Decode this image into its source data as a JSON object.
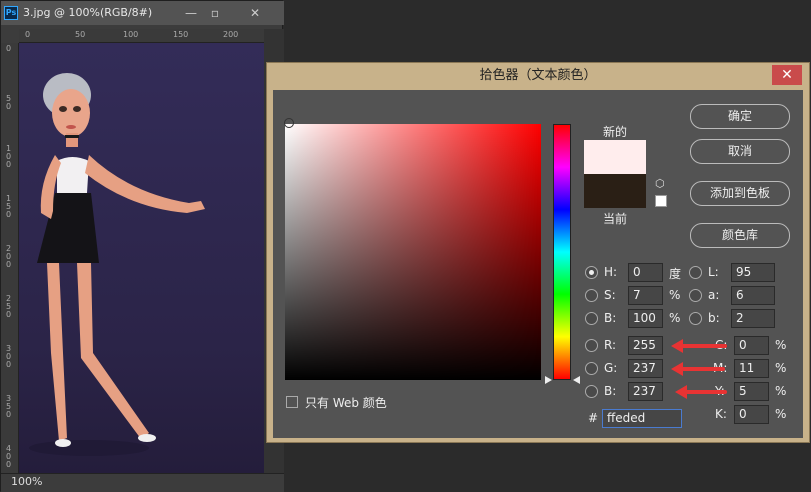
{
  "doc_window": {
    "title": "3.jpg @ 100%(RGB/8#)",
    "ps_logo": "Ps",
    "controls": {
      "minimize": "—",
      "restore": "▫",
      "close": "✕"
    },
    "ruler_h": [
      "0",
      "50",
      "100",
      "150",
      "200"
    ],
    "ruler_v": [
      "0",
      "5\n0",
      "1\n0\n0",
      "1\n5\n0",
      "2\n0\n0",
      "2\n5\n0",
      "3\n0\n0",
      "3\n5\n0",
      "4\n0\n0"
    ],
    "zoom": "100%"
  },
  "dialog": {
    "title": "拾色器（文本颜色）",
    "close": "✕",
    "new_label": "新的",
    "current_label": "当前",
    "new_color": "#ffeded",
    "current_color": "#2a1f15",
    "hue_color": "#ff0000",
    "buttons": {
      "ok": "确定",
      "cancel": "取消",
      "add_swatch": "添加到色板",
      "libraries": "颜色库"
    },
    "web_only": "只有 Web 颜色",
    "hsb": {
      "h": {
        "label": "H:",
        "value": "0",
        "unit": "度"
      },
      "s": {
        "label": "S:",
        "value": "7",
        "unit": "%"
      },
      "b": {
        "label": "B:",
        "value": "100",
        "unit": "%"
      }
    },
    "rgb": {
      "r": {
        "label": "R:",
        "value": "255"
      },
      "g": {
        "label": "G:",
        "value": "237"
      },
      "b": {
        "label": "B:",
        "value": "237"
      }
    },
    "lab": {
      "l": {
        "label": "L:",
        "value": "95"
      },
      "a": {
        "label": "a:",
        "value": "6"
      },
      "b": {
        "label": "b:",
        "value": "2"
      }
    },
    "cmyk": {
      "c": {
        "label": "C:",
        "value": "0",
        "unit": "%"
      },
      "m": {
        "label": "M:",
        "value": "11",
        "unit": "%"
      },
      "y": {
        "label": "Y:",
        "value": "5",
        "unit": "%"
      },
      "k": {
        "label": "K:",
        "value": "0",
        "unit": "%"
      }
    },
    "hex_label": "#",
    "hex": "ffeded",
    "arrow_color": "#e83333"
  }
}
